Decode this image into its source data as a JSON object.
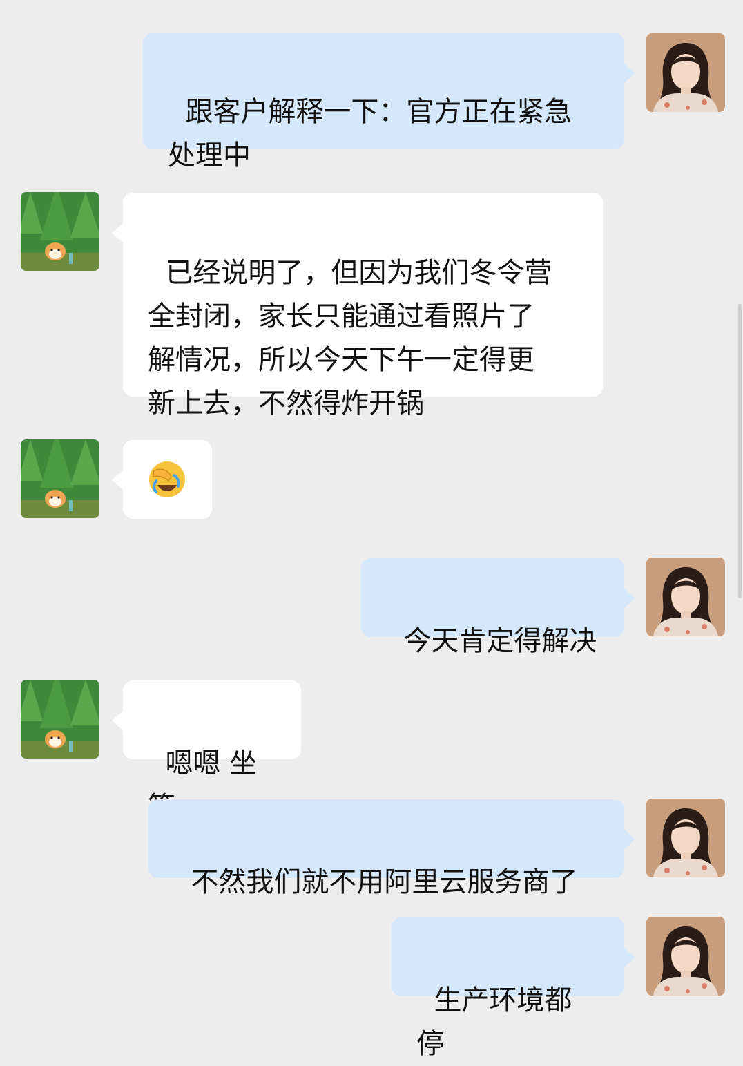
{
  "messages": [
    {
      "sender": "self",
      "avatar": "woman-avatar",
      "text": "跟客户解释一下：官方正在紧急\n处理中"
    },
    {
      "sender": "other",
      "avatar": "forest-hamster-avatar",
      "text": "已经说明了，但因为我们冬令营\n全封闭，家长只能通过看照片了\n解情况，所以今天下午一定得更\n新上去，不然得炸开锅"
    },
    {
      "sender": "other",
      "avatar": "forest-hamster-avatar",
      "emoji": "face-palm-crying-laughing"
    },
    {
      "sender": "self",
      "avatar": "woman-avatar",
      "text": "今天肯定得解决"
    },
    {
      "sender": "other",
      "avatar": "forest-hamster-avatar",
      "text": "嗯嗯 坐等"
    },
    {
      "sender": "self",
      "avatar": "woman-avatar",
      "text": "不然我们就不用阿里云服务商了"
    },
    {
      "sender": "self",
      "avatar": "woman-avatar",
      "text": "生产环境都停"
    }
  ],
  "colors": {
    "background": "#ededed",
    "self_bubble": "#d5e8fb",
    "other_bubble": "#ffffff",
    "text": "#111111"
  }
}
